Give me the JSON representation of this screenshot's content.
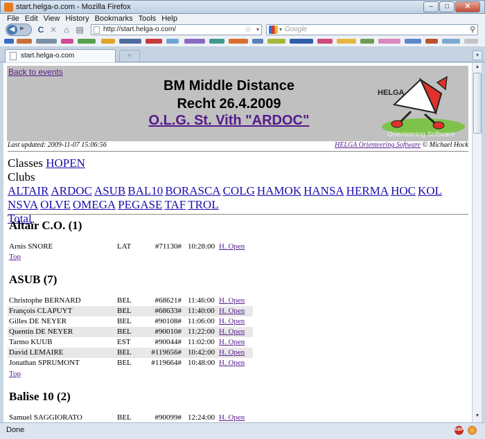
{
  "window": {
    "title": "start.helga-o.com - Mozilla Firefox",
    "min": "–",
    "max": "□",
    "close": "✕"
  },
  "menu": [
    "File",
    "Edit",
    "View",
    "History",
    "Bookmarks",
    "Tools",
    "Help"
  ],
  "nav": {
    "url": "http://start.helga-o.com/",
    "search_placeholder": "Google",
    "back": "◀",
    "forward": "▶",
    "reload": "C",
    "stop": "✕",
    "home": "⌂",
    "print": "▤"
  },
  "tab": {
    "label": "start.helga-o.com",
    "new_tab": "+"
  },
  "status": {
    "text": "Done",
    "abp": "ABP"
  },
  "colors": {
    "link": "#551a8b",
    "header_bg": "#c0c0c0",
    "alt_row": "#e8e8e8"
  },
  "page": {
    "back_link": "Back to events",
    "title1": "BM Middle Distance",
    "title2": "Recht 26.4.2009",
    "title3": "O.L.G. St. Vith \"ARDOC\"",
    "logo_text": "HELGA",
    "logo_caption": "Orienteering Software",
    "last_updated": "Last updated: 2009-11-07 15:06:56",
    "credit_link": "HELGA Orienteering Software",
    "credit_rest": " © Michael Hock",
    "classes_label": "Classes",
    "classes": [
      "HOPEN"
    ],
    "clubs_label": "Clubs",
    "clubs_line1": [
      "ALTAIR",
      "ARDOC",
      "ASUB",
      "BAL10",
      "BORASCA",
      "COLG",
      "HAMOK",
      "HANSA",
      "HERMA",
      "HOC",
      "KOL"
    ],
    "clubs_line2": [
      "NSVA",
      "OLVE",
      "OMEGA",
      "PEGASE",
      "TAF",
      "TROL"
    ],
    "total": "Total",
    "top": "Top",
    "sections": [
      {
        "title": "Altaïr C.O. (1)",
        "rows": [
          {
            "name": "Arnis SNORE",
            "nat": "LAT",
            "no": "#71130#",
            "time": "10:28:00",
            "cls": "H. Open"
          }
        ]
      },
      {
        "title": "ASUB (7)",
        "rows": [
          {
            "name": "Christophe BERNARD",
            "nat": "BEL",
            "no": "#68621#",
            "time": "11:46:00",
            "cls": "H. Open"
          },
          {
            "name": "François CLAPUYT",
            "nat": "BEL",
            "no": "#68633#",
            "time": "11:40:00",
            "cls": "H. Open"
          },
          {
            "name": "Gilles DE NEYER",
            "nat": "BEL",
            "no": "#90108#",
            "time": "11:06:00",
            "cls": "H. Open"
          },
          {
            "name": "Quentin DE NEYER",
            "nat": "BEL",
            "no": "#90010#",
            "time": "11:22:00",
            "cls": "H. Open"
          },
          {
            "name": "Tarmo KUUB",
            "nat": "EST",
            "no": "#90044#",
            "time": "11:02:00",
            "cls": "H. Open"
          },
          {
            "name": "David LEMAIRE",
            "nat": "BEL",
            "no": "#119656#",
            "time": "10:42:00",
            "cls": "H. Open"
          },
          {
            "name": "Jonathan SPRUMONT",
            "nat": "BEL",
            "no": "#119664#",
            "time": "10:48:00",
            "cls": "H. Open"
          }
        ]
      },
      {
        "title": "Balise 10 (2)",
        "rows": [
          {
            "name": "Samuel SAGGIORATO",
            "nat": "BEL",
            "no": "#90099#",
            "time": "12:24:00",
            "cls": "H. Open"
          }
        ]
      }
    ]
  }
}
